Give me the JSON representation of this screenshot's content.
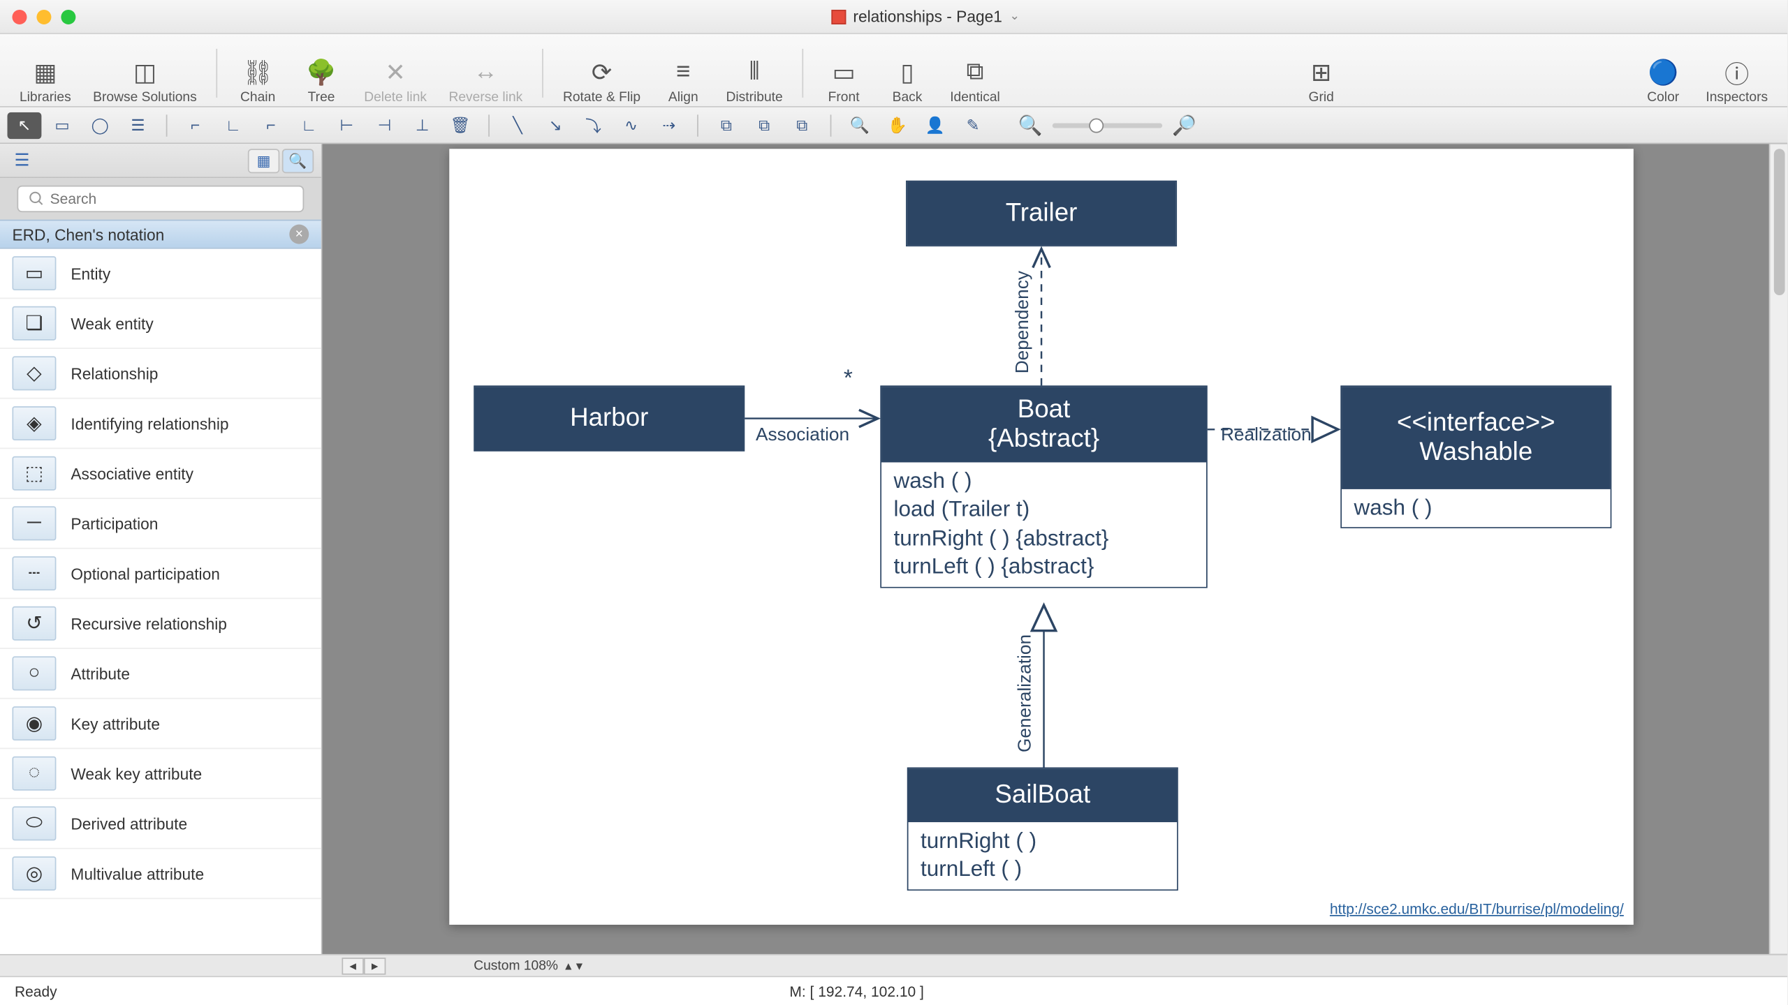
{
  "window": {
    "title": "relationships - Page1"
  },
  "toolbar": [
    {
      "label": "Libraries",
      "icon": "lib",
      "enabled": true
    },
    {
      "label": "Browse Solutions",
      "icon": "browse",
      "enabled": true
    },
    {
      "sep": true
    },
    {
      "label": "Chain",
      "icon": "chain",
      "enabled": true
    },
    {
      "label": "Tree",
      "icon": "tree",
      "enabled": true
    },
    {
      "label": "Delete link",
      "icon": "del",
      "enabled": false
    },
    {
      "label": "Reverse link",
      "icon": "rev",
      "enabled": false
    },
    {
      "sep": true
    },
    {
      "label": "Rotate & Flip",
      "icon": "rot",
      "enabled": true
    },
    {
      "label": "Align",
      "icon": "align",
      "enabled": true
    },
    {
      "label": "Distribute",
      "icon": "dist",
      "enabled": true
    },
    {
      "sep": true
    },
    {
      "label": "Front",
      "icon": "front",
      "enabled": true
    },
    {
      "label": "Back",
      "icon": "back",
      "enabled": true
    },
    {
      "label": "Identical",
      "icon": "ident",
      "enabled": true
    },
    {
      "spacer": true
    },
    {
      "label": "Grid",
      "icon": "grid",
      "enabled": true
    },
    {
      "spacer": true
    },
    {
      "label": "Color",
      "icon": "color",
      "enabled": true
    },
    {
      "label": "Inspectors",
      "icon": "insp",
      "enabled": true
    }
  ],
  "toolbar_icons": {
    "lib": "▦",
    "browse": "◫",
    "chain": "⛓",
    "tree": "🌳",
    "del": "✕",
    "rev": "↔",
    "rot": "⟳",
    "align": "≡",
    "dist": "⫴",
    "front": "▭",
    "back": "▯",
    "ident": "⧉",
    "grid": "⊞",
    "color": "🔵",
    "insp": "ⓘ"
  },
  "toolbar2": [
    "pointer",
    "rect",
    "ellipse",
    "text",
    "|",
    "conn1",
    "conn2",
    "conn3",
    "conn4",
    "conn5",
    "conn6",
    "conn7",
    "trash",
    "|",
    "line1",
    "line2",
    "line3",
    "line4",
    "line5",
    "|",
    "group1",
    "group2",
    "group3",
    "|",
    "zoom-tool",
    "hand",
    "person",
    "eyedrop"
  ],
  "sidebar": {
    "search_placeholder": "Search",
    "header": "ERD, Chen's notation",
    "items": [
      {
        "label": "Entity",
        "glyph": "▭"
      },
      {
        "label": "Weak entity",
        "glyph": "❏"
      },
      {
        "label": "Relationship",
        "glyph": "◇"
      },
      {
        "label": "Identifying relationship",
        "glyph": "◈"
      },
      {
        "label": "Associative entity",
        "glyph": "⬚"
      },
      {
        "label": "Participation",
        "glyph": "─"
      },
      {
        "label": "Optional participation",
        "glyph": "┄"
      },
      {
        "label": "Recursive relationship",
        "glyph": "↺"
      },
      {
        "label": "Attribute",
        "glyph": "○"
      },
      {
        "label": "Key attribute",
        "glyph": "◉"
      },
      {
        "label": "Weak key attribute",
        "glyph": "◌"
      },
      {
        "label": "Derived attribute",
        "glyph": "⬭"
      },
      {
        "label": "Multivalue attribute",
        "glyph": "◎"
      }
    ]
  },
  "diagram": {
    "trailer": {
      "title": "Trailer"
    },
    "harbor": {
      "title": "Harbor"
    },
    "boat": {
      "title": "Boat",
      "sub": "{Abstract}",
      "ops": [
        "wash ( )",
        "load (Trailer t)",
        "turnRight ( ) {abstract}",
        "turnLeft ( ) {abstract}"
      ]
    },
    "washable": {
      "stereo": "<<interface>>",
      "title": "Washable",
      "ops": [
        "wash ( )"
      ]
    },
    "sailboat": {
      "title": "SailBoat",
      "ops": [
        "turnRight ( )",
        "turnLeft ( )"
      ]
    },
    "labels": {
      "dependency": "Dependency",
      "association": "Association",
      "assoc_mult": "*",
      "realization": "Realization",
      "generalization": "Generalization"
    },
    "link": "http://sce2.umkc.edu/BIT/burrise/pl/modeling/"
  },
  "footer": {
    "zoom_label": "Custom 108%",
    "mouse": "M: [ 192.74, 102.10 ]",
    "status": "Ready"
  }
}
